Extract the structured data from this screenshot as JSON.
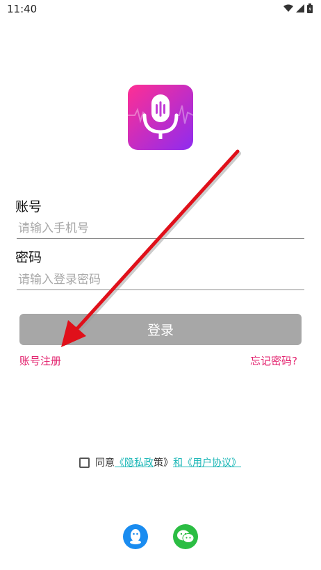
{
  "status_bar": {
    "time": "11:40"
  },
  "account": {
    "label": "账号",
    "placeholder": "请输入手机号"
  },
  "password": {
    "label": "密码",
    "placeholder": "请输入登录密码"
  },
  "login_button": {
    "label": "登录"
  },
  "links": {
    "register": "账号注册",
    "forgot": "忘记密码?"
  },
  "agreement": {
    "prefix": "同意",
    "privacy_a": "《隐私政",
    "privacy_b": "策》",
    "and": "和",
    "user_agreement": "《用户协议》"
  },
  "social": {
    "qq_icon": "qq-icon",
    "wechat_icon": "wechat-icon"
  },
  "colors": {
    "link_pink": "#e3246f",
    "agreement_link": "#19b6b6",
    "login_button_bg": "#a7a7a7",
    "arrow": "#e0101a",
    "logo_gradient": [
      "#ff2f93",
      "#8e2bf0"
    ]
  }
}
